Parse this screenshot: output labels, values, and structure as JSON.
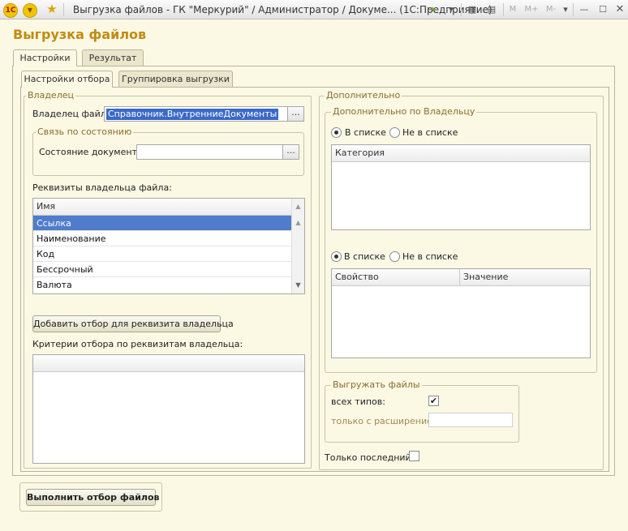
{
  "window": {
    "app_icon": "1C",
    "menu_icon": "▼",
    "title": "Выгрузка файлов - ГК \"Меркурий\" / Администратор /  Докуме...   (1С:Предприятие)",
    "memory_buttons": [
      "M",
      "M+",
      "M-"
    ]
  },
  "form": {
    "title": "Выгрузка файлов"
  },
  "tabs": {
    "settings": "Настройки",
    "result": "Результат"
  },
  "subtabs": {
    "filter": "Настройки отбора",
    "grouping": "Группировка выгрузки"
  },
  "owner_group": {
    "legend": "Владелец",
    "owner_label": "Владелец файла:",
    "owner_value": "Справочник.ВнутренниеДокументы",
    "state_legend": "Связь по состоянию",
    "state_label": "Состояние документа:",
    "state_value": "",
    "requisites_label": "Реквизиты владельца файла:",
    "requisites_header": "Имя",
    "requisites": [
      "Ссылка",
      "Наименование",
      "Код",
      "Бессрочный",
      "Валюта"
    ],
    "add_filter_button": "Добавить отбор для реквизита владельца",
    "criteria_label": "Критерии отбора по реквизитам владельца:"
  },
  "additional": {
    "legend": "Дополнительно",
    "by_owner_legend": "Дополнительно по Владельцу",
    "in_list": "В списке",
    "not_in_list": "Не в списке",
    "category_header": "Категория",
    "in_list2": "В списке",
    "not_in_list2": "Не в списке",
    "property_header": "Свойство",
    "value_header": "Значение"
  },
  "export": {
    "legend": "Выгружать файлы",
    "all_types": "всех типов:",
    "all_types_checked": true,
    "ext_label": "только с расширением:",
    "ext_value": "",
    "last_only": "Только последний:",
    "last_only_checked": false
  },
  "actions": {
    "run": "Выполнить отбор файлов"
  }
}
